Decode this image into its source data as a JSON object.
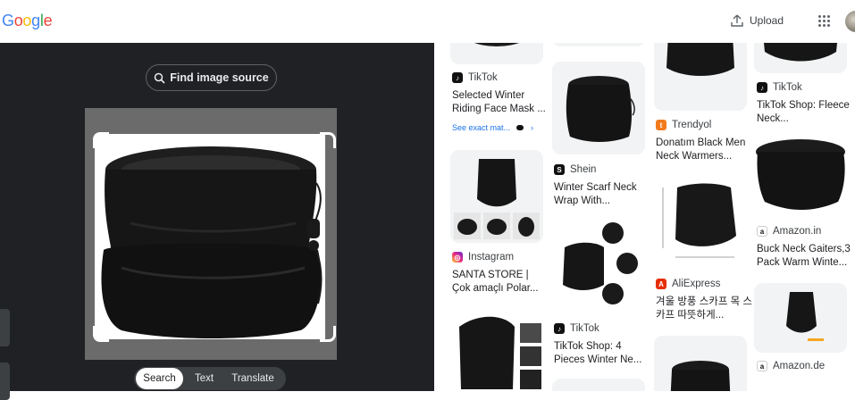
{
  "header": {
    "logo": [
      "G",
      "o",
      "o",
      "g",
      "l",
      "e"
    ],
    "logo_colors": [
      "#4285F4",
      "#EA4335",
      "#FBBC05",
      "#4285F4",
      "#34A853",
      "#EA4335"
    ],
    "upload_label": "Upload"
  },
  "lens": {
    "find_source_label": "Find image source",
    "tabs": [
      "Search",
      "Text",
      "Translate"
    ]
  },
  "results": [
    {
      "source": "TikTok",
      "title": "Selected Winter Riding Face Mask ...",
      "see_exact": "See exact mat...",
      "favicon": "tiktok"
    },
    {
      "source": "Instagram",
      "title": "SANTA STORE | Çok amaçlı Polar...",
      "favicon": "instagram"
    },
    {
      "source": "Shein",
      "title": "Winter Scarf Neck Wrap With...",
      "favicon": "shein"
    },
    {
      "source": "TikTok",
      "title": "TikTok Shop: 4 Pieces Winter Ne...",
      "favicon": "tiktok"
    },
    {
      "source": "Trendyol",
      "title": "Donatım Black Men Neck Warmers...",
      "favicon": "trendyol"
    },
    {
      "source": "AliExpress",
      "title": "겨울 방풍 스카프 목 스카프 따뜻하게...",
      "favicon": "aliexpress"
    },
    {
      "source": "TikTok",
      "title": "TikTok Shop: Fleece Neck...",
      "favicon": "tiktok"
    },
    {
      "source": "Amazon.in",
      "title": "Buck Neck Gaiters,3 Pack Warm Winte...",
      "favicon": "amazon"
    },
    {
      "source": "Amazon.de",
      "title": "",
      "favicon": "amazon"
    }
  ],
  "colors": {
    "dark_panel": "#202124",
    "accent": "#1a73e8"
  }
}
